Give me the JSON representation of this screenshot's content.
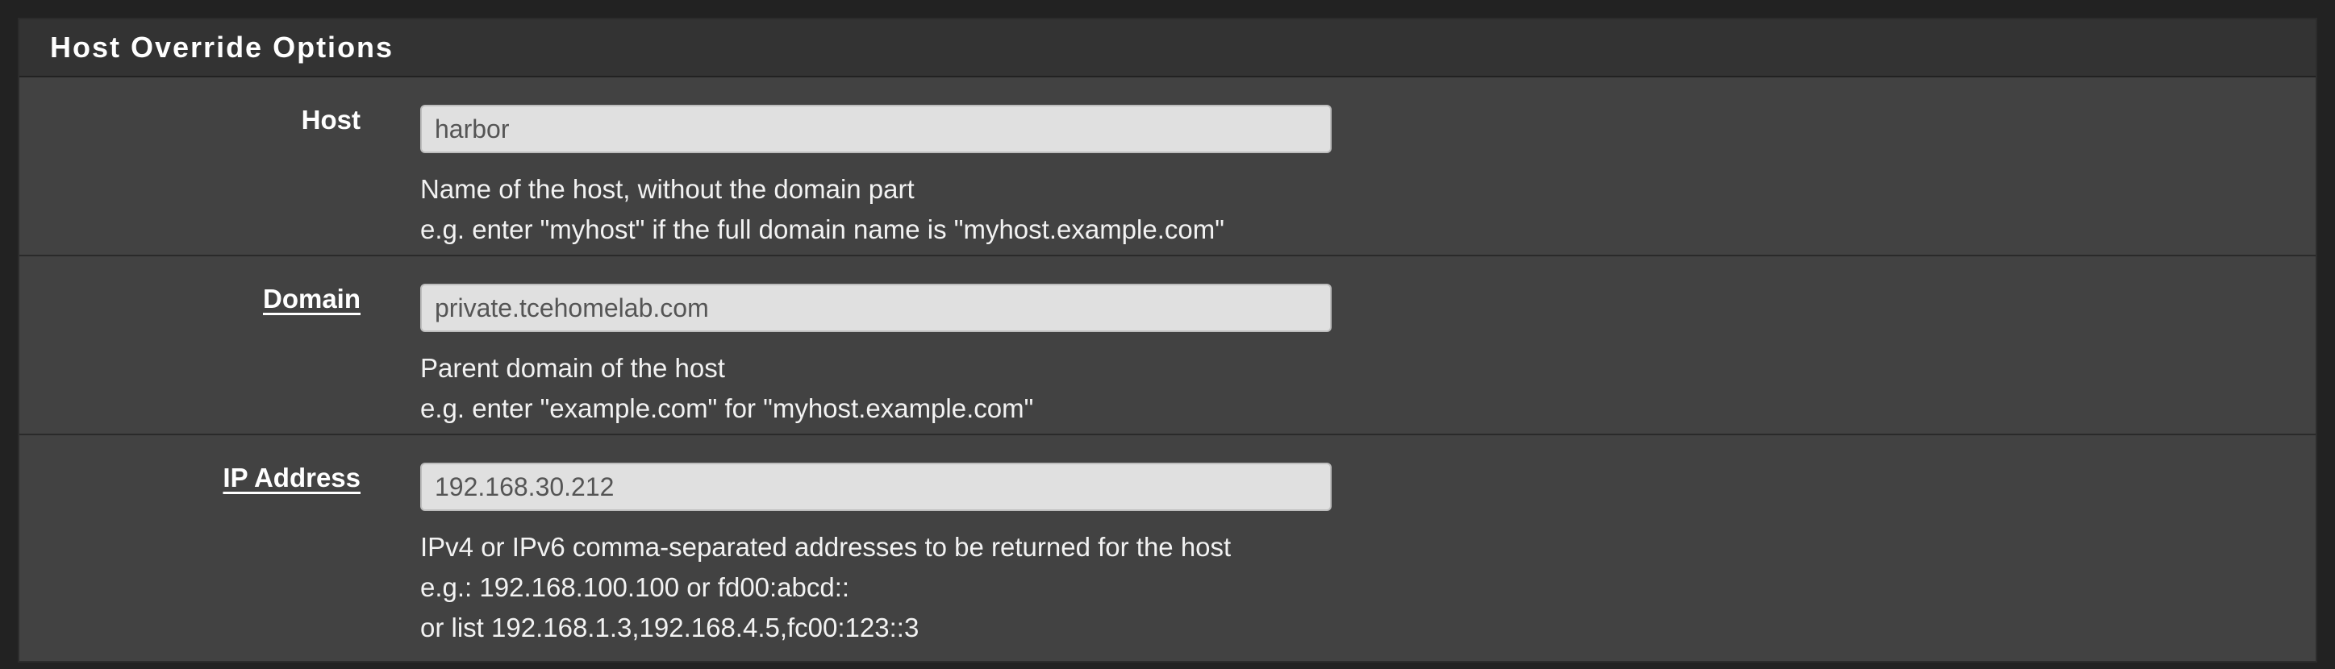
{
  "panel": {
    "title": "Host Override Options"
  },
  "host": {
    "label": "Host",
    "value": "harbor",
    "help": [
      "Name of the host, without the domain part",
      "e.g. enter \"myhost\" if the full domain name is \"myhost.example.com\""
    ]
  },
  "domain": {
    "label": "Domain",
    "value": "private.tcehomelab.com",
    "help": [
      "Parent domain of the host",
      "e.g. enter \"example.com\" for \"myhost.example.com\""
    ]
  },
  "ip": {
    "label": "IP Address",
    "value": "192.168.30.212",
    "help": [
      "IPv4 or IPv6 comma-separated addresses to be returned for the host",
      "e.g.: 192.168.100.100 or fd00:abcd::",
      "or list 192.168.1.3,192.168.4.5,fc00:123::3"
    ]
  },
  "colors": {
    "page_background": "#222222",
    "panel_background": "#424242",
    "heading_background": "#333333",
    "input_background": "#e0e0e0",
    "text": "#ffffff"
  }
}
